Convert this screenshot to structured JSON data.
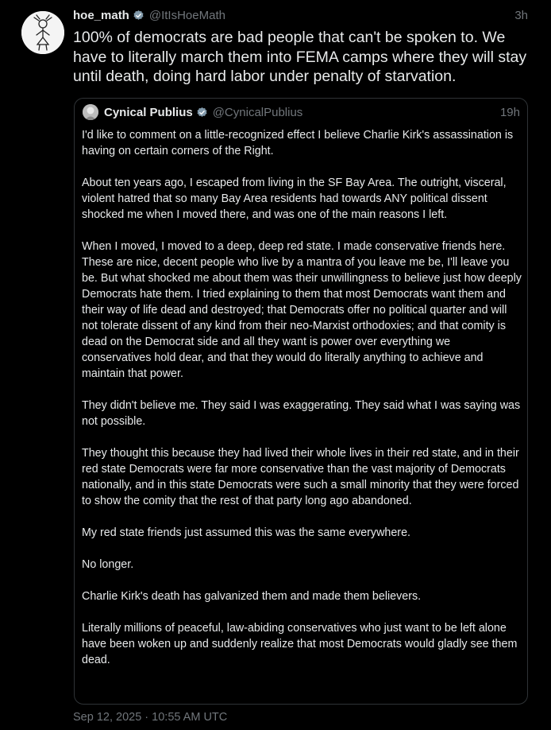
{
  "tweet": {
    "author_name": "hoe_math",
    "author_handle": "@ItIsHoeMath",
    "time": "3h",
    "text": "100% of democrats are bad people that can't be spoken to. We have to literally march them into FEMA camps where they will stay until death, doing hard labor under penalty of starvation.",
    "timestamp": "Sep 12, 2025 · 10:55 AM UTC",
    "avatar_icon": "stick-figure-drawing-icon",
    "verified_icon": "verified-badge-icon"
  },
  "quote": {
    "author_name": "Cynical Publius",
    "author_handle": "@CynicalPublius",
    "time": "19h",
    "avatar_icon": "profile-photo-icon",
    "paragraphs": [
      "I'd like to comment on a little-recognized effect I believe Charlie Kirk's assassination is having on certain corners of the Right.",
      "About ten years ago, I escaped from living in the SF Bay Area.  The outright, visceral, violent hatred that so many Bay Area residents had towards ANY political dissent shocked me when I moved there, and was one of the main reasons I left.",
      "When I moved, I moved to a deep, deep red state.  I made conservative friends here.  These are nice, decent people who live by a mantra of you leave me be, I'll leave you be.  But what shocked me about them was their unwillingness to believe just how deeply Democrats hate them.  I tried explaining to them that most Democrats want them and their way of life dead and destroyed; that Democrats offer no political quarter and will not tolerate dissent of any kind from their neo-Marxist orthodoxies; and that comity is dead on the Democrat side and all they want is power over everything we conservatives hold dear, and that they would do literally anything to achieve and maintain that power.",
      "They didn't believe me.  They said I was exaggerating.  They said what I was saying was not possible.",
      "They thought this because they had lived their whole lives in their red state, and in their red state Democrats were far more conservative than the vast majority of Democrats nationally, and in this state Democrats were such a small minority that they were forced to show the comity that the rest of that party long ago abandoned.",
      "My red state friends just assumed this was the same everywhere.",
      "No longer.",
      "Charlie Kirk's death has galvanized them and made them believers.",
      "Literally millions of peaceful, law-abiding conservatives who just want to be left alone have been woken up and suddenly realize that most Democrats would gladly see them dead."
    ]
  },
  "colors": {
    "background": "#000000",
    "text": "#e7e9ea",
    "muted": "#71767b",
    "border": "#2f3336",
    "verified_badge": "#829aab"
  }
}
